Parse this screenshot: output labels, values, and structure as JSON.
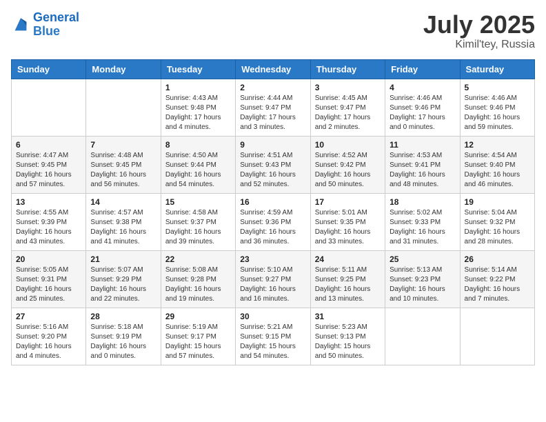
{
  "header": {
    "logo_line1": "General",
    "logo_line2": "Blue",
    "month_title": "July 2025",
    "location": "Kimil'tey, Russia"
  },
  "weekdays": [
    "Sunday",
    "Monday",
    "Tuesday",
    "Wednesday",
    "Thursday",
    "Friday",
    "Saturday"
  ],
  "weeks": [
    [
      {
        "day": "",
        "content": ""
      },
      {
        "day": "",
        "content": ""
      },
      {
        "day": "1",
        "content": "Sunrise: 4:43 AM\nSunset: 9:48 PM\nDaylight: 17 hours and 4 minutes."
      },
      {
        "day": "2",
        "content": "Sunrise: 4:44 AM\nSunset: 9:47 PM\nDaylight: 17 hours and 3 minutes."
      },
      {
        "day": "3",
        "content": "Sunrise: 4:45 AM\nSunset: 9:47 PM\nDaylight: 17 hours and 2 minutes."
      },
      {
        "day": "4",
        "content": "Sunrise: 4:46 AM\nSunset: 9:46 PM\nDaylight: 17 hours and 0 minutes."
      },
      {
        "day": "5",
        "content": "Sunrise: 4:46 AM\nSunset: 9:46 PM\nDaylight: 16 hours and 59 minutes."
      }
    ],
    [
      {
        "day": "6",
        "content": "Sunrise: 4:47 AM\nSunset: 9:45 PM\nDaylight: 16 hours and 57 minutes."
      },
      {
        "day": "7",
        "content": "Sunrise: 4:48 AM\nSunset: 9:45 PM\nDaylight: 16 hours and 56 minutes."
      },
      {
        "day": "8",
        "content": "Sunrise: 4:50 AM\nSunset: 9:44 PM\nDaylight: 16 hours and 54 minutes."
      },
      {
        "day": "9",
        "content": "Sunrise: 4:51 AM\nSunset: 9:43 PM\nDaylight: 16 hours and 52 minutes."
      },
      {
        "day": "10",
        "content": "Sunrise: 4:52 AM\nSunset: 9:42 PM\nDaylight: 16 hours and 50 minutes."
      },
      {
        "day": "11",
        "content": "Sunrise: 4:53 AM\nSunset: 9:41 PM\nDaylight: 16 hours and 48 minutes."
      },
      {
        "day": "12",
        "content": "Sunrise: 4:54 AM\nSunset: 9:40 PM\nDaylight: 16 hours and 46 minutes."
      }
    ],
    [
      {
        "day": "13",
        "content": "Sunrise: 4:55 AM\nSunset: 9:39 PM\nDaylight: 16 hours and 43 minutes."
      },
      {
        "day": "14",
        "content": "Sunrise: 4:57 AM\nSunset: 9:38 PM\nDaylight: 16 hours and 41 minutes."
      },
      {
        "day": "15",
        "content": "Sunrise: 4:58 AM\nSunset: 9:37 PM\nDaylight: 16 hours and 39 minutes."
      },
      {
        "day": "16",
        "content": "Sunrise: 4:59 AM\nSunset: 9:36 PM\nDaylight: 16 hours and 36 minutes."
      },
      {
        "day": "17",
        "content": "Sunrise: 5:01 AM\nSunset: 9:35 PM\nDaylight: 16 hours and 33 minutes."
      },
      {
        "day": "18",
        "content": "Sunrise: 5:02 AM\nSunset: 9:33 PM\nDaylight: 16 hours and 31 minutes."
      },
      {
        "day": "19",
        "content": "Sunrise: 5:04 AM\nSunset: 9:32 PM\nDaylight: 16 hours and 28 minutes."
      }
    ],
    [
      {
        "day": "20",
        "content": "Sunrise: 5:05 AM\nSunset: 9:31 PM\nDaylight: 16 hours and 25 minutes."
      },
      {
        "day": "21",
        "content": "Sunrise: 5:07 AM\nSunset: 9:29 PM\nDaylight: 16 hours and 22 minutes."
      },
      {
        "day": "22",
        "content": "Sunrise: 5:08 AM\nSunset: 9:28 PM\nDaylight: 16 hours and 19 minutes."
      },
      {
        "day": "23",
        "content": "Sunrise: 5:10 AM\nSunset: 9:27 PM\nDaylight: 16 hours and 16 minutes."
      },
      {
        "day": "24",
        "content": "Sunrise: 5:11 AM\nSunset: 9:25 PM\nDaylight: 16 hours and 13 minutes."
      },
      {
        "day": "25",
        "content": "Sunrise: 5:13 AM\nSunset: 9:23 PM\nDaylight: 16 hours and 10 minutes."
      },
      {
        "day": "26",
        "content": "Sunrise: 5:14 AM\nSunset: 9:22 PM\nDaylight: 16 hours and 7 minutes."
      }
    ],
    [
      {
        "day": "27",
        "content": "Sunrise: 5:16 AM\nSunset: 9:20 PM\nDaylight: 16 hours and 4 minutes."
      },
      {
        "day": "28",
        "content": "Sunrise: 5:18 AM\nSunset: 9:19 PM\nDaylight: 16 hours and 0 minutes."
      },
      {
        "day": "29",
        "content": "Sunrise: 5:19 AM\nSunset: 9:17 PM\nDaylight: 15 hours and 57 minutes."
      },
      {
        "day": "30",
        "content": "Sunrise: 5:21 AM\nSunset: 9:15 PM\nDaylight: 15 hours and 54 minutes."
      },
      {
        "day": "31",
        "content": "Sunrise: 5:23 AM\nSunset: 9:13 PM\nDaylight: 15 hours and 50 minutes."
      },
      {
        "day": "",
        "content": ""
      },
      {
        "day": "",
        "content": ""
      }
    ]
  ]
}
